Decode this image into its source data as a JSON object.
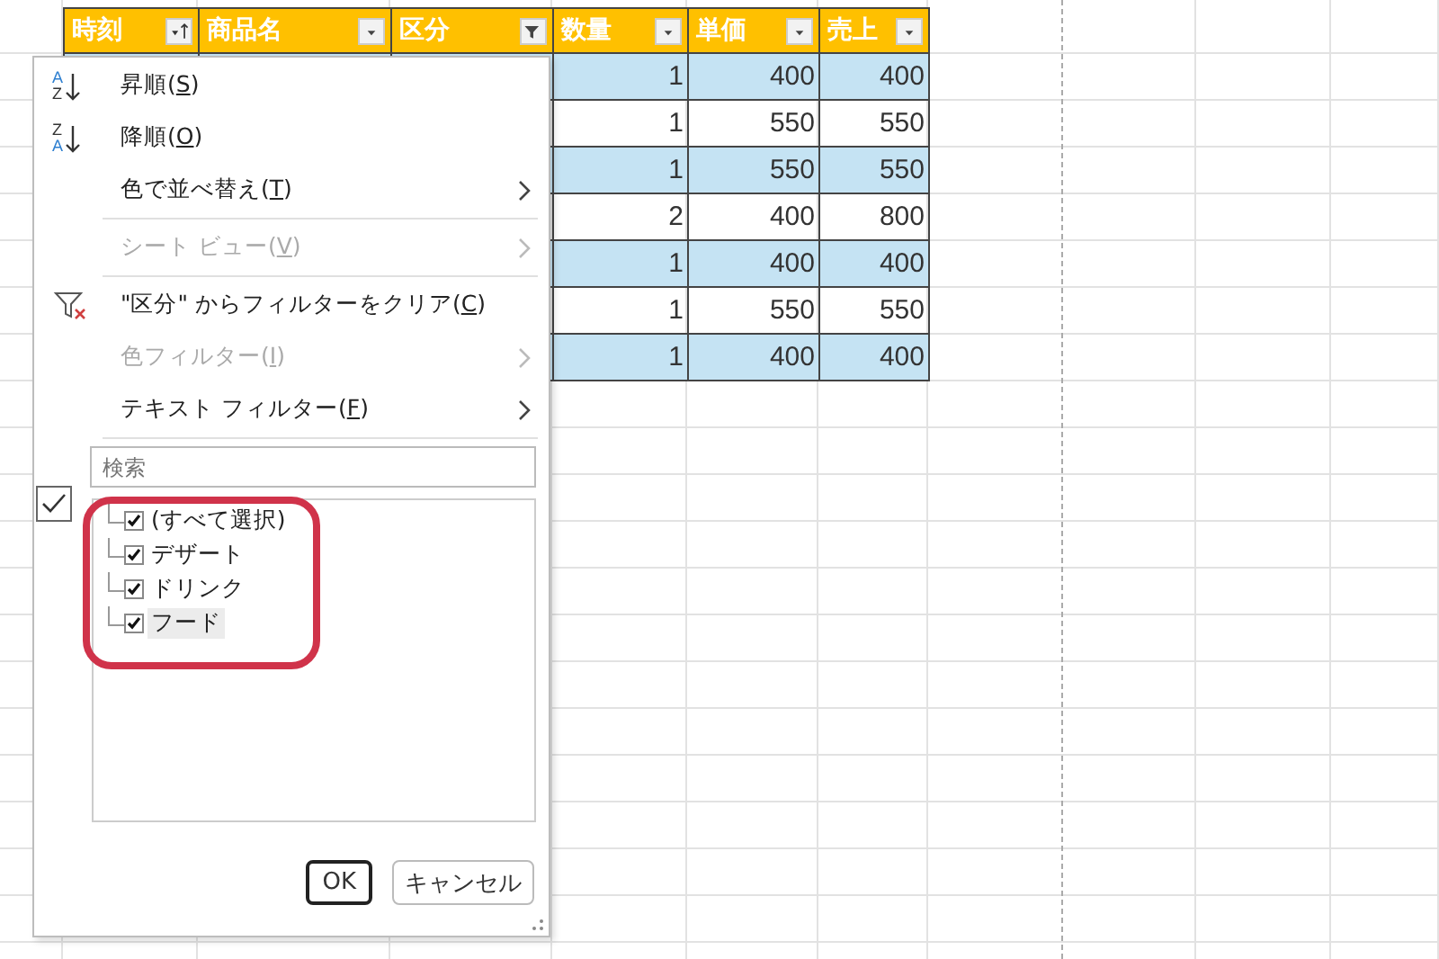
{
  "table": {
    "columns": [
      {
        "label": "時刻",
        "sorted": true,
        "filtered": false
      },
      {
        "label": "商品名",
        "sorted": false,
        "filtered": false
      },
      {
        "label": "区分",
        "sorted": false,
        "filtered": true
      },
      {
        "label": "数量",
        "sorted": false,
        "filtered": false
      },
      {
        "label": "単価",
        "sorted": false,
        "filtered": false
      },
      {
        "label": "売上",
        "sorted": false,
        "filtered": false
      }
    ],
    "rows": [
      [
        "1",
        "400",
        "400"
      ],
      [
        "1",
        "550",
        "550"
      ],
      [
        "1",
        "550",
        "550"
      ],
      [
        "2",
        "400",
        "800"
      ],
      [
        "1",
        "400",
        "400"
      ],
      [
        "1",
        "550",
        "550"
      ],
      [
        "1",
        "400",
        "400"
      ]
    ]
  },
  "filter_menu": {
    "items": [
      {
        "kind": "sort",
        "label": "昇順(S)",
        "icon_letters": [
          "A",
          "Z"
        ],
        "disabled": false,
        "submenu": false
      },
      {
        "kind": "sort",
        "label": "降順(O)",
        "icon_letters": [
          "Z",
          "A"
        ],
        "disabled": false,
        "submenu": false
      },
      {
        "kind": "item",
        "label": "色で並べ替え(T)",
        "disabled": false,
        "submenu": true
      },
      {
        "kind": "separator"
      },
      {
        "kind": "item",
        "label": "シート ビュー(V)",
        "disabled": true,
        "submenu": true
      },
      {
        "kind": "separator"
      },
      {
        "kind": "clear-filter",
        "label": "\"区分\" からフィルターをクリア(C)",
        "disabled": false,
        "submenu": false
      },
      {
        "kind": "item",
        "label": "色フィルター(I)",
        "disabled": true,
        "submenu": true
      },
      {
        "kind": "item",
        "label": "テキスト フィルター(F)",
        "disabled": false,
        "submenu": true
      },
      {
        "kind": "separator"
      }
    ],
    "search": {
      "placeholder": "検索"
    },
    "select_all_toggle": {
      "checked": true
    },
    "values": [
      {
        "label": "(すべて選択)",
        "checked": true,
        "selected": false
      },
      {
        "label": "デザート",
        "checked": true,
        "selected": false
      },
      {
        "label": "ドリンク",
        "checked": true,
        "selected": false
      },
      {
        "label": "フード",
        "checked": true,
        "selected": true
      }
    ],
    "buttons": [
      {
        "label": "OK",
        "default": true
      },
      {
        "label": "キャンセル",
        "default": false
      }
    ]
  }
}
